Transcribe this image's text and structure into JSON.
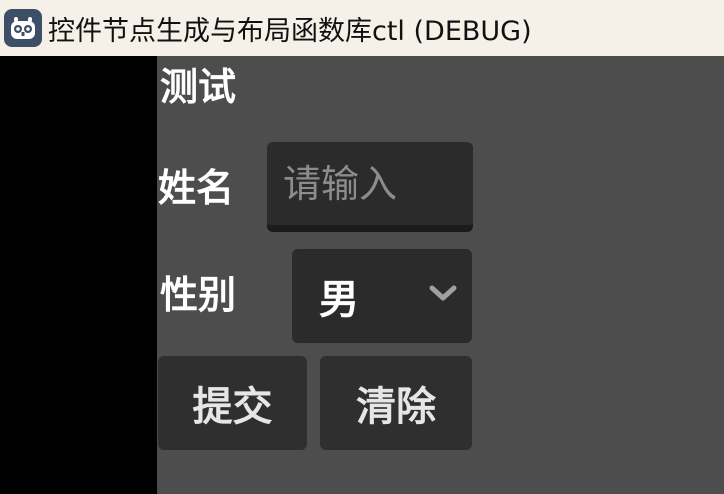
{
  "window": {
    "title": "控件节点生成与布局函数库ctl (DEBUG)",
    "icon": "godot-engine-icon"
  },
  "form": {
    "heading": "测试",
    "name_label": "姓名",
    "name_placeholder": "请输入",
    "name_value": "",
    "gender_label": "性别",
    "gender_selected": "男",
    "submit_label": "提交",
    "clear_label": "清除"
  },
  "colors": {
    "titlebar_bg": "#f5f1e8",
    "content_bg": "#4d4d4d",
    "control_bg": "#2b2b2b",
    "left_pane_bg": "#000000"
  }
}
